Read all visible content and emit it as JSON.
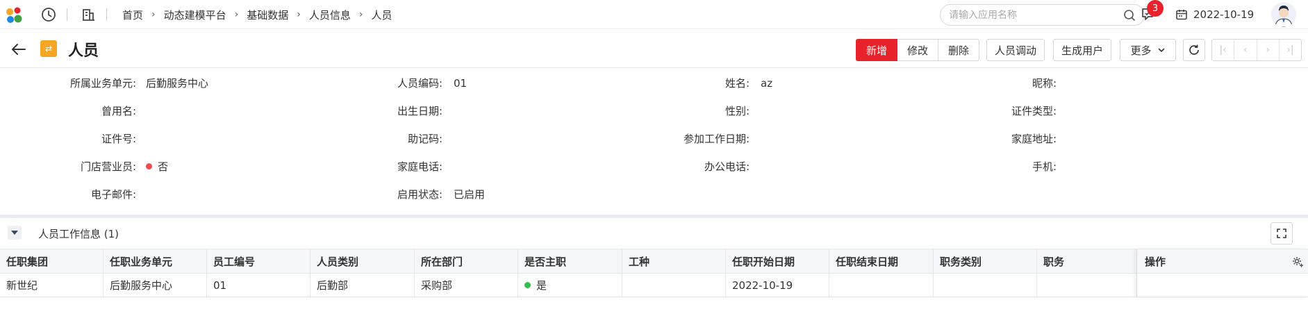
{
  "topbar": {
    "breadcrumb": [
      "首页",
      "动态建模平台",
      "基础数据",
      "人员信息",
      "人员"
    ],
    "search_placeholder": "请输入应用名称",
    "notification_count": "3",
    "date": "2022-10-19",
    "icons": [
      "app-logo",
      "history-icon",
      "building-icon",
      "search-icon",
      "notification-icon",
      "calendar-icon",
      "avatar"
    ]
  },
  "header": {
    "title": "人员",
    "buttons": {
      "add": "新增",
      "edit": "修改",
      "delete": "删除",
      "transfer": "人员调动",
      "create_user": "生成用户",
      "more": "更多"
    }
  },
  "form": {
    "row1": {
      "unit_label": "所属业务单元:",
      "unit_value": "后勤服务中心",
      "code_label": "人员编码:",
      "code_value": "01",
      "name_label": "姓名:",
      "name_value": "az",
      "nickname_label": "昵称:"
    },
    "row2": {
      "used_name_label": "曾用名:",
      "birth_label": "出生日期:",
      "gender_label": "性别:",
      "id_type_label": "证件类型:"
    },
    "row3": {
      "id_no_label": "证件号:",
      "mnemonic_label": "助记码:",
      "work_date_label": "参加工作日期:",
      "address_label": "家庭地址:"
    },
    "row4": {
      "store_label": "门店营业员:",
      "store_value": "否",
      "home_phone_label": "家庭电话:",
      "office_phone_label": "办公电话:",
      "mobile_label": "手机:"
    },
    "row5": {
      "email_label": "电子邮件:",
      "status_label": "启用状态:",
      "status_value": "已启用"
    }
  },
  "section": {
    "title": "人员工作信息 (1)"
  },
  "table": {
    "columns": [
      "任职集团",
      "任职业务单元",
      "员工编号",
      "人员类别",
      "所在部门",
      "是否主职",
      "工种",
      "任职开始日期",
      "任职结束日期",
      "职务类别",
      "职务",
      "操作"
    ],
    "rows": [
      [
        "新世纪",
        "后勤服务中心",
        "01",
        "后勤部",
        "采购部",
        "是",
        "",
        "2022-10-19",
        "",
        "",
        "",
        ""
      ]
    ]
  },
  "colors": {
    "accent": "#e8222b",
    "no_dot": "#f04b4b",
    "yes_dot": "#2fbf4a",
    "title_icon": "#f5a623"
  }
}
